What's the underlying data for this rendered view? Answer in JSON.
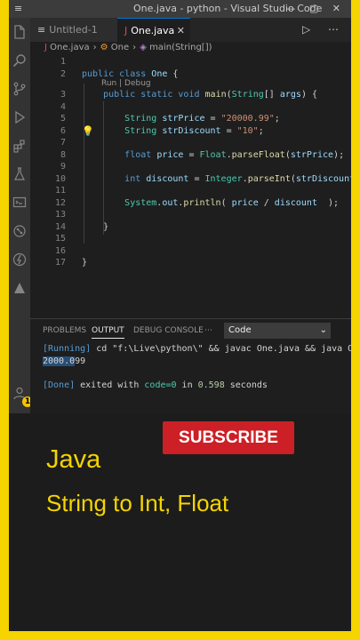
{
  "window": {
    "title": "One.java - python - Visual Studio Code",
    "menu_icon": "≡",
    "controls": "— ▢ ✕"
  },
  "activity_bar": {
    "icons": [
      "files-icon",
      "search-icon",
      "source-control-icon",
      "run-debug-icon",
      "extensions-icon",
      "testing-icon",
      "remote-explorer-icon",
      "git-graph-icon",
      "python-icon",
      "azure-icon",
      "account-icon"
    ],
    "badge_count": "1"
  },
  "tabs": [
    {
      "label": "Untitled-1",
      "icon": "≡",
      "active": false
    },
    {
      "label": "One.java",
      "icon": "J",
      "active": true
    }
  ],
  "tab_actions": "▷ ⋯",
  "breadcrumb": {
    "file": "One.java",
    "class": "One",
    "method": "main(String[])"
  },
  "editor": {
    "codelens": "Run | Debug",
    "lines": [
      {
        "num": "1",
        "text": ""
      },
      {
        "num": "2",
        "text": "public class One {"
      },
      {
        "num": "3",
        "text": "    public static void main(String[] args) {"
      },
      {
        "num": "4",
        "text": ""
      },
      {
        "num": "5",
        "text": "        String strPrice = \"20000.99\";"
      },
      {
        "num": "6",
        "text": "        String strDiscount = \"10\";"
      },
      {
        "num": "7",
        "text": ""
      },
      {
        "num": "8",
        "text": "        float price = Float.parseFloat(strPrice);"
      },
      {
        "num": "9",
        "text": ""
      },
      {
        "num": "10",
        "text": "        int discount = Integer.parseInt(strDiscount);"
      },
      {
        "num": "11",
        "text": ""
      },
      {
        "num": "12",
        "text": "        System.out.println( price / discount  );"
      },
      {
        "num": "13",
        "text": ""
      },
      {
        "num": "14",
        "text": "    }"
      },
      {
        "num": "15",
        "text": ""
      },
      {
        "num": "16",
        "text": ""
      },
      {
        "num": "17",
        "text": "}"
      }
    ]
  },
  "panel": {
    "tabs": [
      "PROBLEMS",
      "OUTPUT",
      "DEBUG CONSOLE",
      "⋯"
    ],
    "active_tab": "OUTPUT",
    "output_channel": "Code",
    "running_tag": "[Running]",
    "running_cmd": " cd \"f:\\Live\\python\\\" && javac One.java && java One",
    "result_selected": "2000.0",
    "result_rest": "99",
    "done_tag": "[Done]",
    "done_text": " exited with ",
    "done_code": "code=0",
    "done_in": " in ",
    "done_time": "0.598",
    "done_seconds": " seconds"
  },
  "banner": {
    "subscribe_label": "SUBSCRIBE",
    "language": "Java",
    "topic": "String to Int, Float"
  },
  "colors": {
    "frame": "#f5d400",
    "subscribe": "#cc1f26",
    "accent": "#0078d4"
  }
}
